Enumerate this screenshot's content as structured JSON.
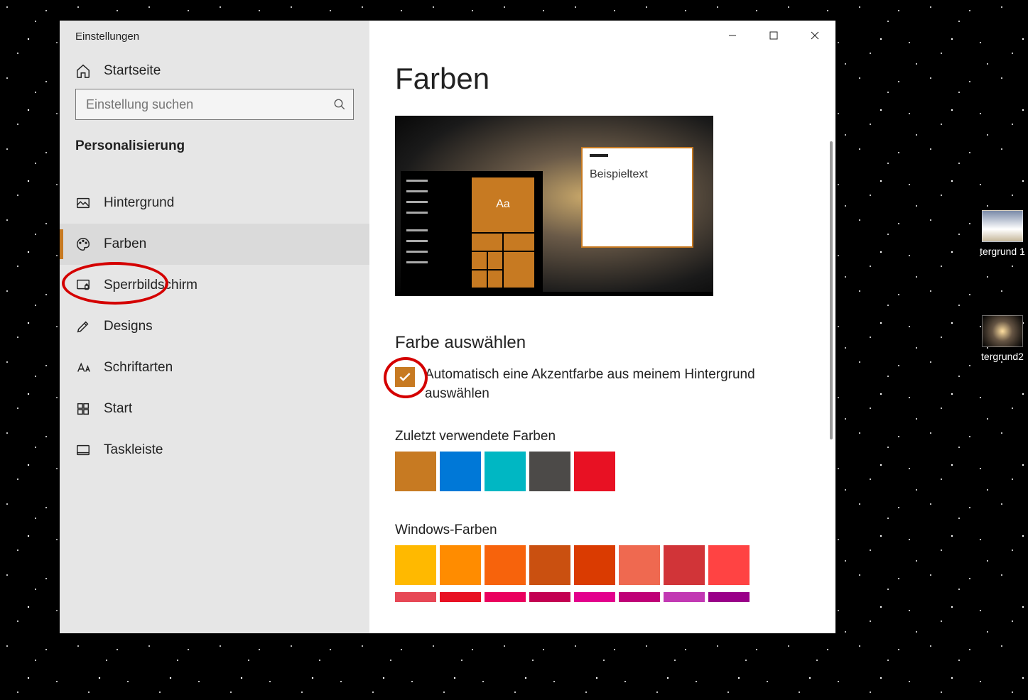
{
  "window": {
    "title": "Einstellungen"
  },
  "sidebar": {
    "home_label": "Startseite",
    "search_placeholder": "Einstellung suchen",
    "category_label": "Personalisierung",
    "items": [
      {
        "label": "Hintergrund",
        "icon": "image-icon",
        "active": false
      },
      {
        "label": "Farben",
        "icon": "palette-icon",
        "active": true
      },
      {
        "label": "Sperrbildschirm",
        "icon": "lockscreen-icon",
        "active": false
      },
      {
        "label": "Designs",
        "icon": "brush-icon",
        "active": false
      },
      {
        "label": "Schriftarten",
        "icon": "font-icon",
        "active": false
      },
      {
        "label": "Start",
        "icon": "grid-icon",
        "active": false
      },
      {
        "label": "Taskleiste",
        "icon": "taskbar-icon",
        "active": false
      }
    ]
  },
  "content": {
    "page_title": "Farben",
    "preview": {
      "sample_text_label": "Beispieltext",
      "tile_text": "Aa",
      "accent_color": "#c77a22"
    },
    "pick_color_heading": "Farbe auswählen",
    "auto_accent_checkbox": {
      "checked": true,
      "label": "Automatisch eine Akzentfarbe aus meinem Hintergrund auswählen"
    },
    "recent_colors_label": "Zuletzt verwendete Farben",
    "recent_colors": [
      "#c77a22",
      "#0078d7",
      "#00b7c3",
      "#4c4a48",
      "#e81123"
    ],
    "windows_colors_label": "Windows-Farben",
    "windows_colors_rows": [
      [
        "#ffb900",
        "#ff8c00",
        "#f7630c",
        "#ca5010",
        "#da3b01",
        "#ef6950",
        "#d13438",
        "#ff4343"
      ],
      [
        "#e74856",
        "#e81123",
        "#ea005e",
        "#c30052",
        "#e3008c",
        "#bf0077",
        "#c239b3",
        "#9a0089"
      ]
    ]
  },
  "desktop": {
    "icon1_label": "tergrund 1",
    "icon2_label": "tergrund2"
  }
}
